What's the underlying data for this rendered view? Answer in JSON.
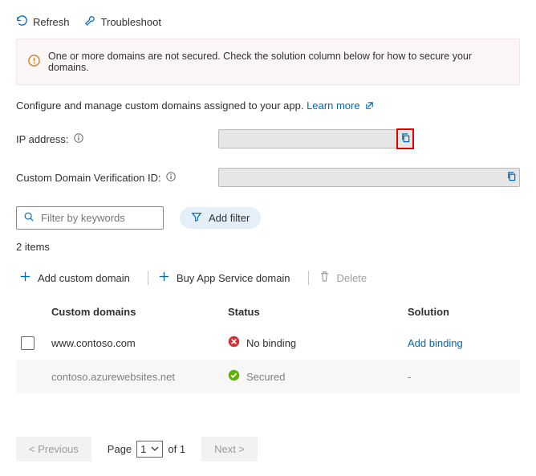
{
  "toolbar": {
    "refresh": "Refresh",
    "troubleshoot": "Troubleshoot"
  },
  "alert": {
    "text": "One or more domains are not secured. Check the solution column below for how to secure your domains."
  },
  "description": {
    "text": "Configure and manage custom domains assigned to your app.",
    "learn_more": "Learn more"
  },
  "fields": {
    "ip_label": "IP address:",
    "ip_value": "",
    "cdv_label": "Custom Domain Verification ID:",
    "cdv_value": ""
  },
  "filters": {
    "keyword_placeholder": "Filter by keywords",
    "add_filter": "Add filter"
  },
  "items_count": "2 items",
  "actions": {
    "add_domain": "Add custom domain",
    "buy_domain": "Buy App Service domain",
    "delete": "Delete"
  },
  "table": {
    "columns": {
      "domain": "Custom domains",
      "status": "Status",
      "solution": "Solution"
    },
    "rows": [
      {
        "domain": "www.contoso.com",
        "status": "No binding",
        "status_type": "error",
        "solution": "Add binding",
        "selectable": true
      },
      {
        "domain": "contoso.azurewebsites.net",
        "status": "Secured",
        "status_type": "ok",
        "solution": "-",
        "selectable": false
      }
    ]
  },
  "pager": {
    "prev": "< Previous",
    "page_label": "Page",
    "page_value": "1",
    "of_label": "of 1",
    "next": "Next >"
  }
}
